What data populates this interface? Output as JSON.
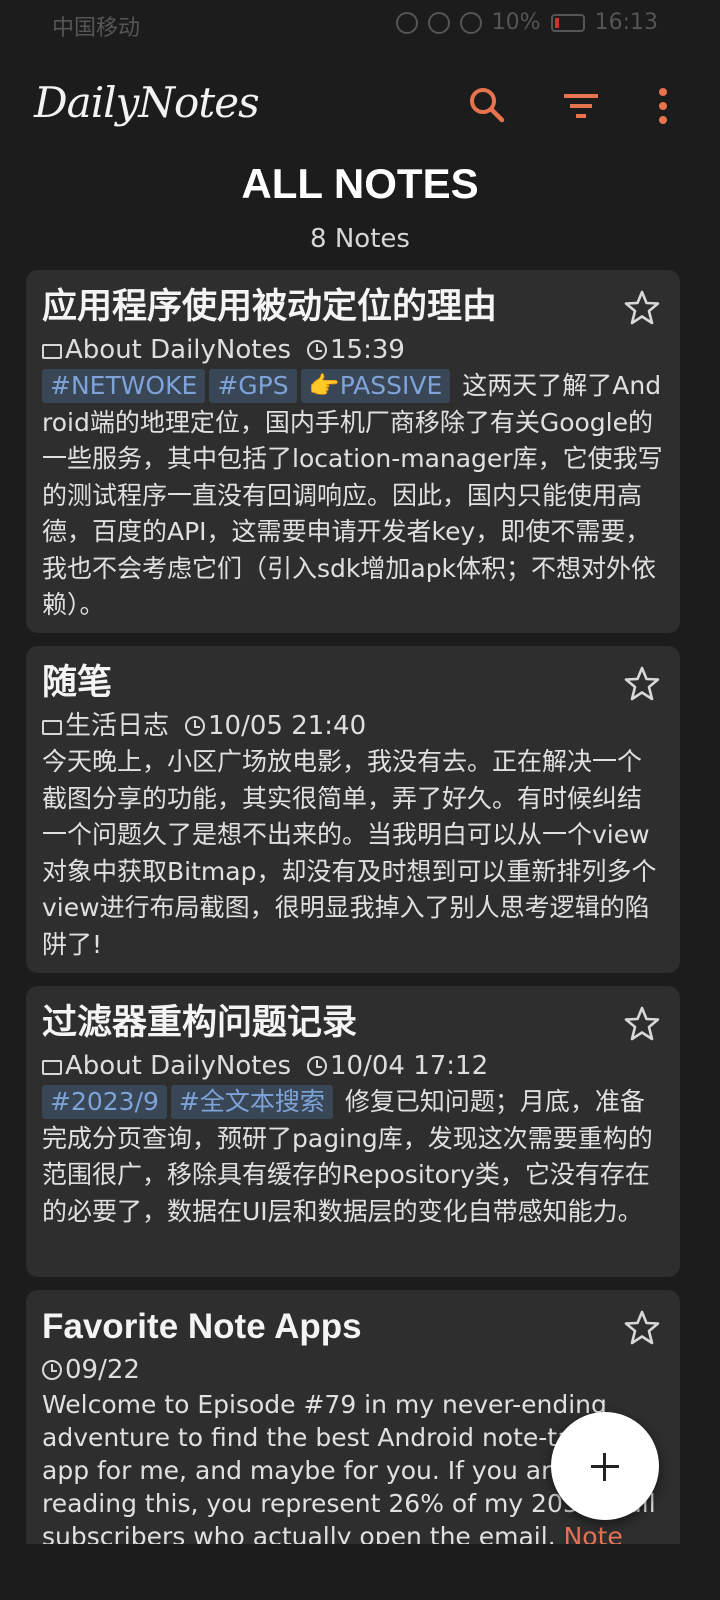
{
  "status_bar": {
    "carrier": "中国移动",
    "battery": "10%",
    "time": "16:13"
  },
  "app": {
    "logo": "DailyNotes",
    "accent": "#e8744f"
  },
  "header": {
    "title": "ALL NOTES",
    "count": "8 Notes"
  },
  "notes": [
    {
      "title": "应用程序使用被动定位的理由",
      "folder": "About DailyNotes",
      "time": "15:39",
      "tags": [
        "#NETWOKE",
        "#GPS",
        "👉PASSIVE"
      ],
      "body": "这两天了解了Android端的地理定位，国内手机厂商移除了有关Google的一些服务，其中包括了location-manager库，它使我写的测试程序一直没有回调响应。因此，国内只能使用高德，百度的API，这需要申请开发者key，即使不需要，我也不会考虑它们（引入sdk增加apk体积；不想对外依赖）。"
    },
    {
      "title": "随笔",
      "folder": "生活日志",
      "time": "10/05 21:40",
      "tags": [],
      "body": "今天晚上，小区广场放电影，我没有去。正在解决一个截图分享的功能，其实很简单，弄了好久。有时候纠结一个问题久了是想不出来的。当我明白可以从一个view对象中获取Bitmap，却没有及时想到可以重新排列多个view进行布局截图，很明显我掉入了别人思考逻辑的陷阱了!"
    },
    {
      "title": "过滤器重构问题记录",
      "folder": "About DailyNotes",
      "time": "10/04 17:12",
      "tags": [
        "#2023/9",
        "#全文本搜索"
      ],
      "body": "修复已知问题；月底，准备完成分页查询，预研了paging库，发现这次需要重构的范围很广，移除具有缓存的Repository类，它没有存在的必要了，数据在UI层和数据层的变化自带感知能力。"
    },
    {
      "title": "Favorite Note Apps",
      "folder": "",
      "time": "09/22",
      "tags": [],
      "body": "Welcome to Episode #79 in my never-ending adventure to find the best Android note-taking app for me, and maybe for you. If you are reading this, you represent 26% of my 205 email subscribers who actually open the email.",
      "link": "Note"
    }
  ]
}
